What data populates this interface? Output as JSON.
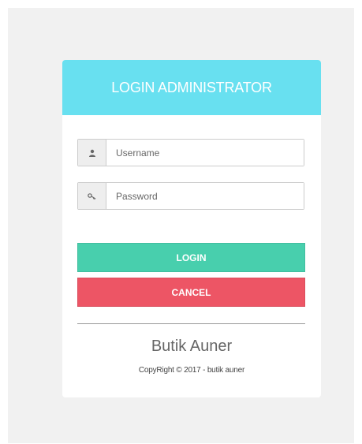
{
  "header": {
    "title": "LOGIN ADMINISTRATOR"
  },
  "form": {
    "username": {
      "icon": "user-icon",
      "placeholder": "Username",
      "value": ""
    },
    "password": {
      "icon": "key-icon",
      "placeholder": "Password",
      "value": ""
    },
    "login_label": "LOGIN",
    "cancel_label": "CANCEL"
  },
  "footer": {
    "brand": "Butik Auner",
    "copyright": "CopyRight © 2017 - butik auner"
  },
  "colors": {
    "header": "#68e0f0",
    "login": "#48cfad",
    "cancel": "#ed5565"
  }
}
